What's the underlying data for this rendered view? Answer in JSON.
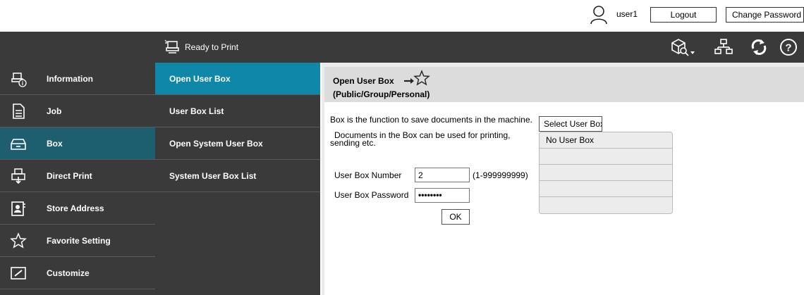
{
  "user_bar": {
    "username": "user1",
    "logout_label": "Logout",
    "change_password_label": "Change Password"
  },
  "header": {
    "status_text": "Ready to Print",
    "icons": [
      "box-search-icon",
      "network-icon",
      "refresh-icon",
      "help-icon"
    ]
  },
  "left_nav": {
    "active_index": 2,
    "items": [
      {
        "label": "Information",
        "icon": "information-icon"
      },
      {
        "label": "Job",
        "icon": "job-icon"
      },
      {
        "label": "Box",
        "icon": "box-icon"
      },
      {
        "label": "Direct Print",
        "icon": "direct-print-icon"
      },
      {
        "label": "Store Address",
        "icon": "store-address-icon"
      },
      {
        "label": "Favorite Setting",
        "icon": "star-icon"
      },
      {
        "label": "Customize",
        "icon": "customize-icon"
      }
    ]
  },
  "sub_nav": {
    "active_index": 0,
    "items": [
      {
        "label": "Open User Box"
      },
      {
        "label": "User Box List"
      },
      {
        "label": "Open System User Box"
      },
      {
        "label": "System User Box List"
      }
    ]
  },
  "main": {
    "title": "Open User Box",
    "subtitle": "(Public/Group/Personal)",
    "description_1": "Box is the function to save documents in the machine.",
    "description_2": "Documents in the Box can be used for printing, sending etc.",
    "box_number_label": "User Box Number",
    "box_number_value": "2",
    "box_number_range": "(1-999999999)",
    "box_password_label": "User Box Password",
    "box_password_value": "••••••••",
    "ok_label": "OK",
    "select_box_label": "Select User Box",
    "box_list": [
      "No User Box",
      "",
      "",
      "",
      ""
    ]
  },
  "colors": {
    "header_bg": "#3a3a3a",
    "left_active": "#1d5f6e",
    "sub_active": "#0e87a8",
    "panel_head_bg": "#dcdcdc"
  }
}
